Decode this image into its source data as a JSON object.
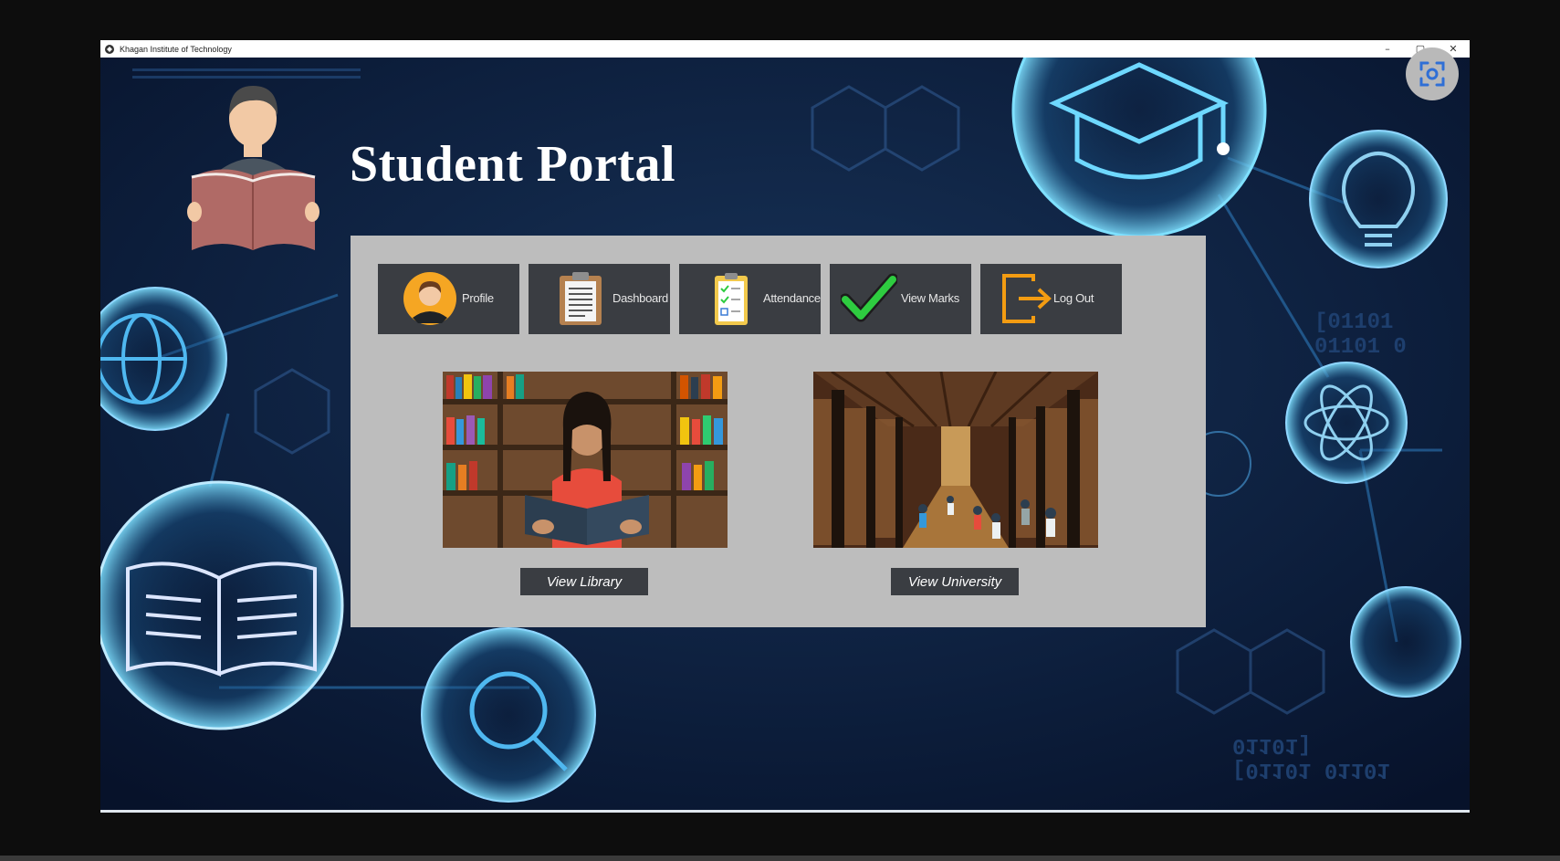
{
  "window": {
    "title": "Khagan Institute of Technology",
    "controls": {
      "minimize": "–",
      "maximize": "▢",
      "close": "✕"
    }
  },
  "page": {
    "title": "Student Portal"
  },
  "nav": [
    {
      "label": "Profile",
      "icon": "profile-icon"
    },
    {
      "label": "Dashboard",
      "icon": "clipboard-icon"
    },
    {
      "label": "Attendance",
      "icon": "checklist-icon"
    },
    {
      "label": "View Marks",
      "icon": "checkmark-icon"
    },
    {
      "label": "Log Out",
      "icon": "logout-icon"
    }
  ],
  "gallery": [
    {
      "button_label": "View Library",
      "image": "library-reading-photo"
    },
    {
      "button_label": "View University",
      "image": "university-hall-photo"
    }
  ],
  "background": {
    "binary_text_1": "[01101 01101 0",
    "binary_text_2": "[01101 01101 01101]"
  },
  "colors": {
    "background": "#0b1a33",
    "glow": "#3fc3ff",
    "panel": "#bdbdbd",
    "button": "#3a3d42",
    "accent_orange": "#f39c12",
    "check_green": "#2ecc40"
  }
}
